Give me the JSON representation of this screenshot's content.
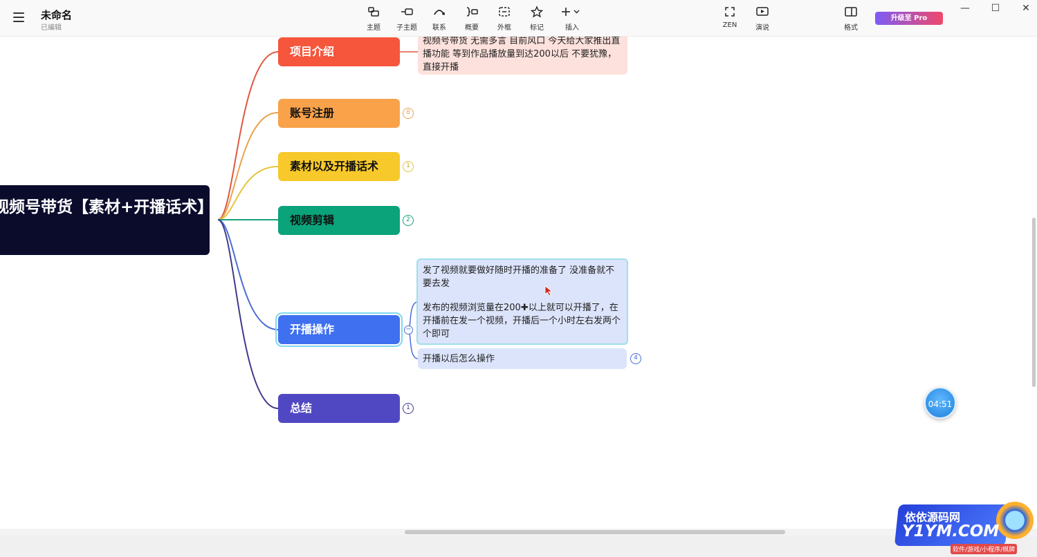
{
  "app": {
    "title": "未命名",
    "subtitle": "已编辑"
  },
  "toolbar": {
    "tools": [
      {
        "label": "主题",
        "icon": "topic-icon"
      },
      {
        "label": "子主题",
        "icon": "subtopic-icon"
      },
      {
        "label": "联系",
        "icon": "relationship-icon"
      },
      {
        "label": "概要",
        "icon": "summary-icon"
      },
      {
        "label": "外框",
        "icon": "boundary-icon"
      },
      {
        "label": "标记",
        "icon": "star-icon"
      },
      {
        "label": "插入",
        "icon": "plus-icon"
      }
    ],
    "right_tools": [
      {
        "label": "ZEN",
        "icon": "fullscreen-icon"
      },
      {
        "label": "演说",
        "icon": "play-icon"
      },
      {
        "label": "格式",
        "icon": "format-panel-icon"
      }
    ],
    "pro_label": "升级至 Pro"
  },
  "mindmap": {
    "root": "视频号带货【素材+开播话术】",
    "branches": [
      {
        "label": "项目介绍",
        "color": "#f5563c",
        "text_color": "#ffffff"
      },
      {
        "label": "账号注册",
        "color": "#f9a24a",
        "text_color": "#111111",
        "badge": "8"
      },
      {
        "label": "素材以及开播话术",
        "color": "#f8c92a",
        "text_color": "#111111",
        "badge": "1"
      },
      {
        "label": "视频剪辑",
        "color": "#0aa37a",
        "text_color": "#111111",
        "badge": "2"
      },
      {
        "label": "开播操作",
        "color": "#3f70f0",
        "text_color": "#ffffff"
      },
      {
        "label": "总结",
        "color": "#5048c2",
        "text_color": "#ffffff",
        "badge": "1"
      }
    ],
    "intro_note": "视频号带货 无需多言 目前风口 今天给大家推出直播功能 等到作品播放量到达200以后 不要犹豫，直接开播",
    "live_notes": {
      "note1": "发了视频就要做好随时开播的准备了  没准备就不要去发",
      "note2": "发布的视频浏览量在200✚以上就可以开播了，在开播前在发一个视频，开播后一个小时左右发两个个即可",
      "note3": "开播以后怎么操作",
      "note3_badge": "4"
    }
  },
  "timer": "04:51",
  "watermark": {
    "line1": "依依源码网",
    "line2": "Y1YM.COM",
    "line3": "软件/游戏/小程序/棋牌"
  }
}
